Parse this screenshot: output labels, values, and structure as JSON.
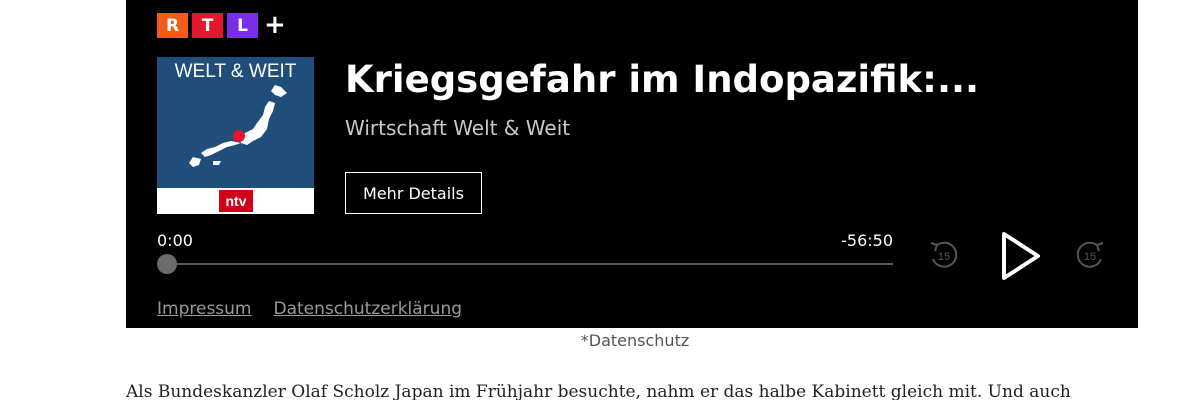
{
  "brand": {
    "logo_letters": [
      "R",
      "T",
      "L"
    ],
    "logo_plus": "+",
    "logo_colors": [
      "#f25c19",
      "#e5152e",
      "#7a2fe6"
    ]
  },
  "episode": {
    "cover_title": "WELT & WEIT",
    "cover_badge": "ntv",
    "title": "Kriegsgefahr im Indopazifik:...",
    "podcast": "Wirtschaft Welt & Weit",
    "details_label": "Mehr Details"
  },
  "player": {
    "elapsed": "0:00",
    "remaining": "-56:50",
    "progress": 0,
    "rewind_icon": "rewind-15-icon",
    "rewind_label": "15",
    "play_icon": "play-icon",
    "forward_icon": "forward-15-icon",
    "forward_label": "15"
  },
  "footer": {
    "links": [
      "Impressum",
      "Datenschutzerklärung"
    ]
  },
  "caption": "*Datenschutz",
  "article": {
    "text": "Als Bundeskanzler Olaf Scholz Japan im Frühjahr besuchte, nahm er das halbe Kabinett gleich mit. Und auch"
  }
}
